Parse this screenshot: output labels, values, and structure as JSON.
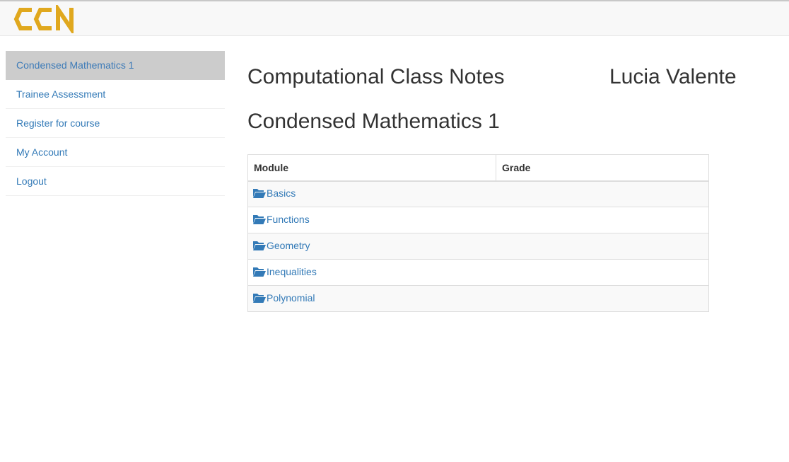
{
  "header": {
    "logo_text": "CCN",
    "brand_color": "#e0a81e"
  },
  "sidebar": {
    "items": [
      {
        "label": "Condensed Mathematics 1",
        "active": true
      },
      {
        "label": "Trainee Assessment",
        "active": false
      },
      {
        "label": "Register for course",
        "active": false
      },
      {
        "label": "My Account",
        "active": false
      },
      {
        "label": "Logout",
        "active": false
      }
    ]
  },
  "main": {
    "app_title": "Computational Class Notes",
    "user_name": "Lucia Valente",
    "course_title": "Condensed Mathematics 1",
    "table": {
      "headers": [
        "Module",
        "Grade"
      ],
      "rows": [
        {
          "module": "Basics",
          "grade": "",
          "icon": "folder-open-icon"
        },
        {
          "module": "Functions",
          "grade": "",
          "icon": "folder-open-icon"
        },
        {
          "module": "Geometry",
          "grade": "",
          "icon": "folder-open-icon"
        },
        {
          "module": "Inequalities",
          "grade": "",
          "icon": "folder-open-icon"
        },
        {
          "module": "Polynomial",
          "grade": "",
          "icon": "folder-open-icon"
        }
      ]
    }
  },
  "colors": {
    "link": "#337ab7",
    "active_bg": "#cccccc",
    "text": "#333333"
  }
}
